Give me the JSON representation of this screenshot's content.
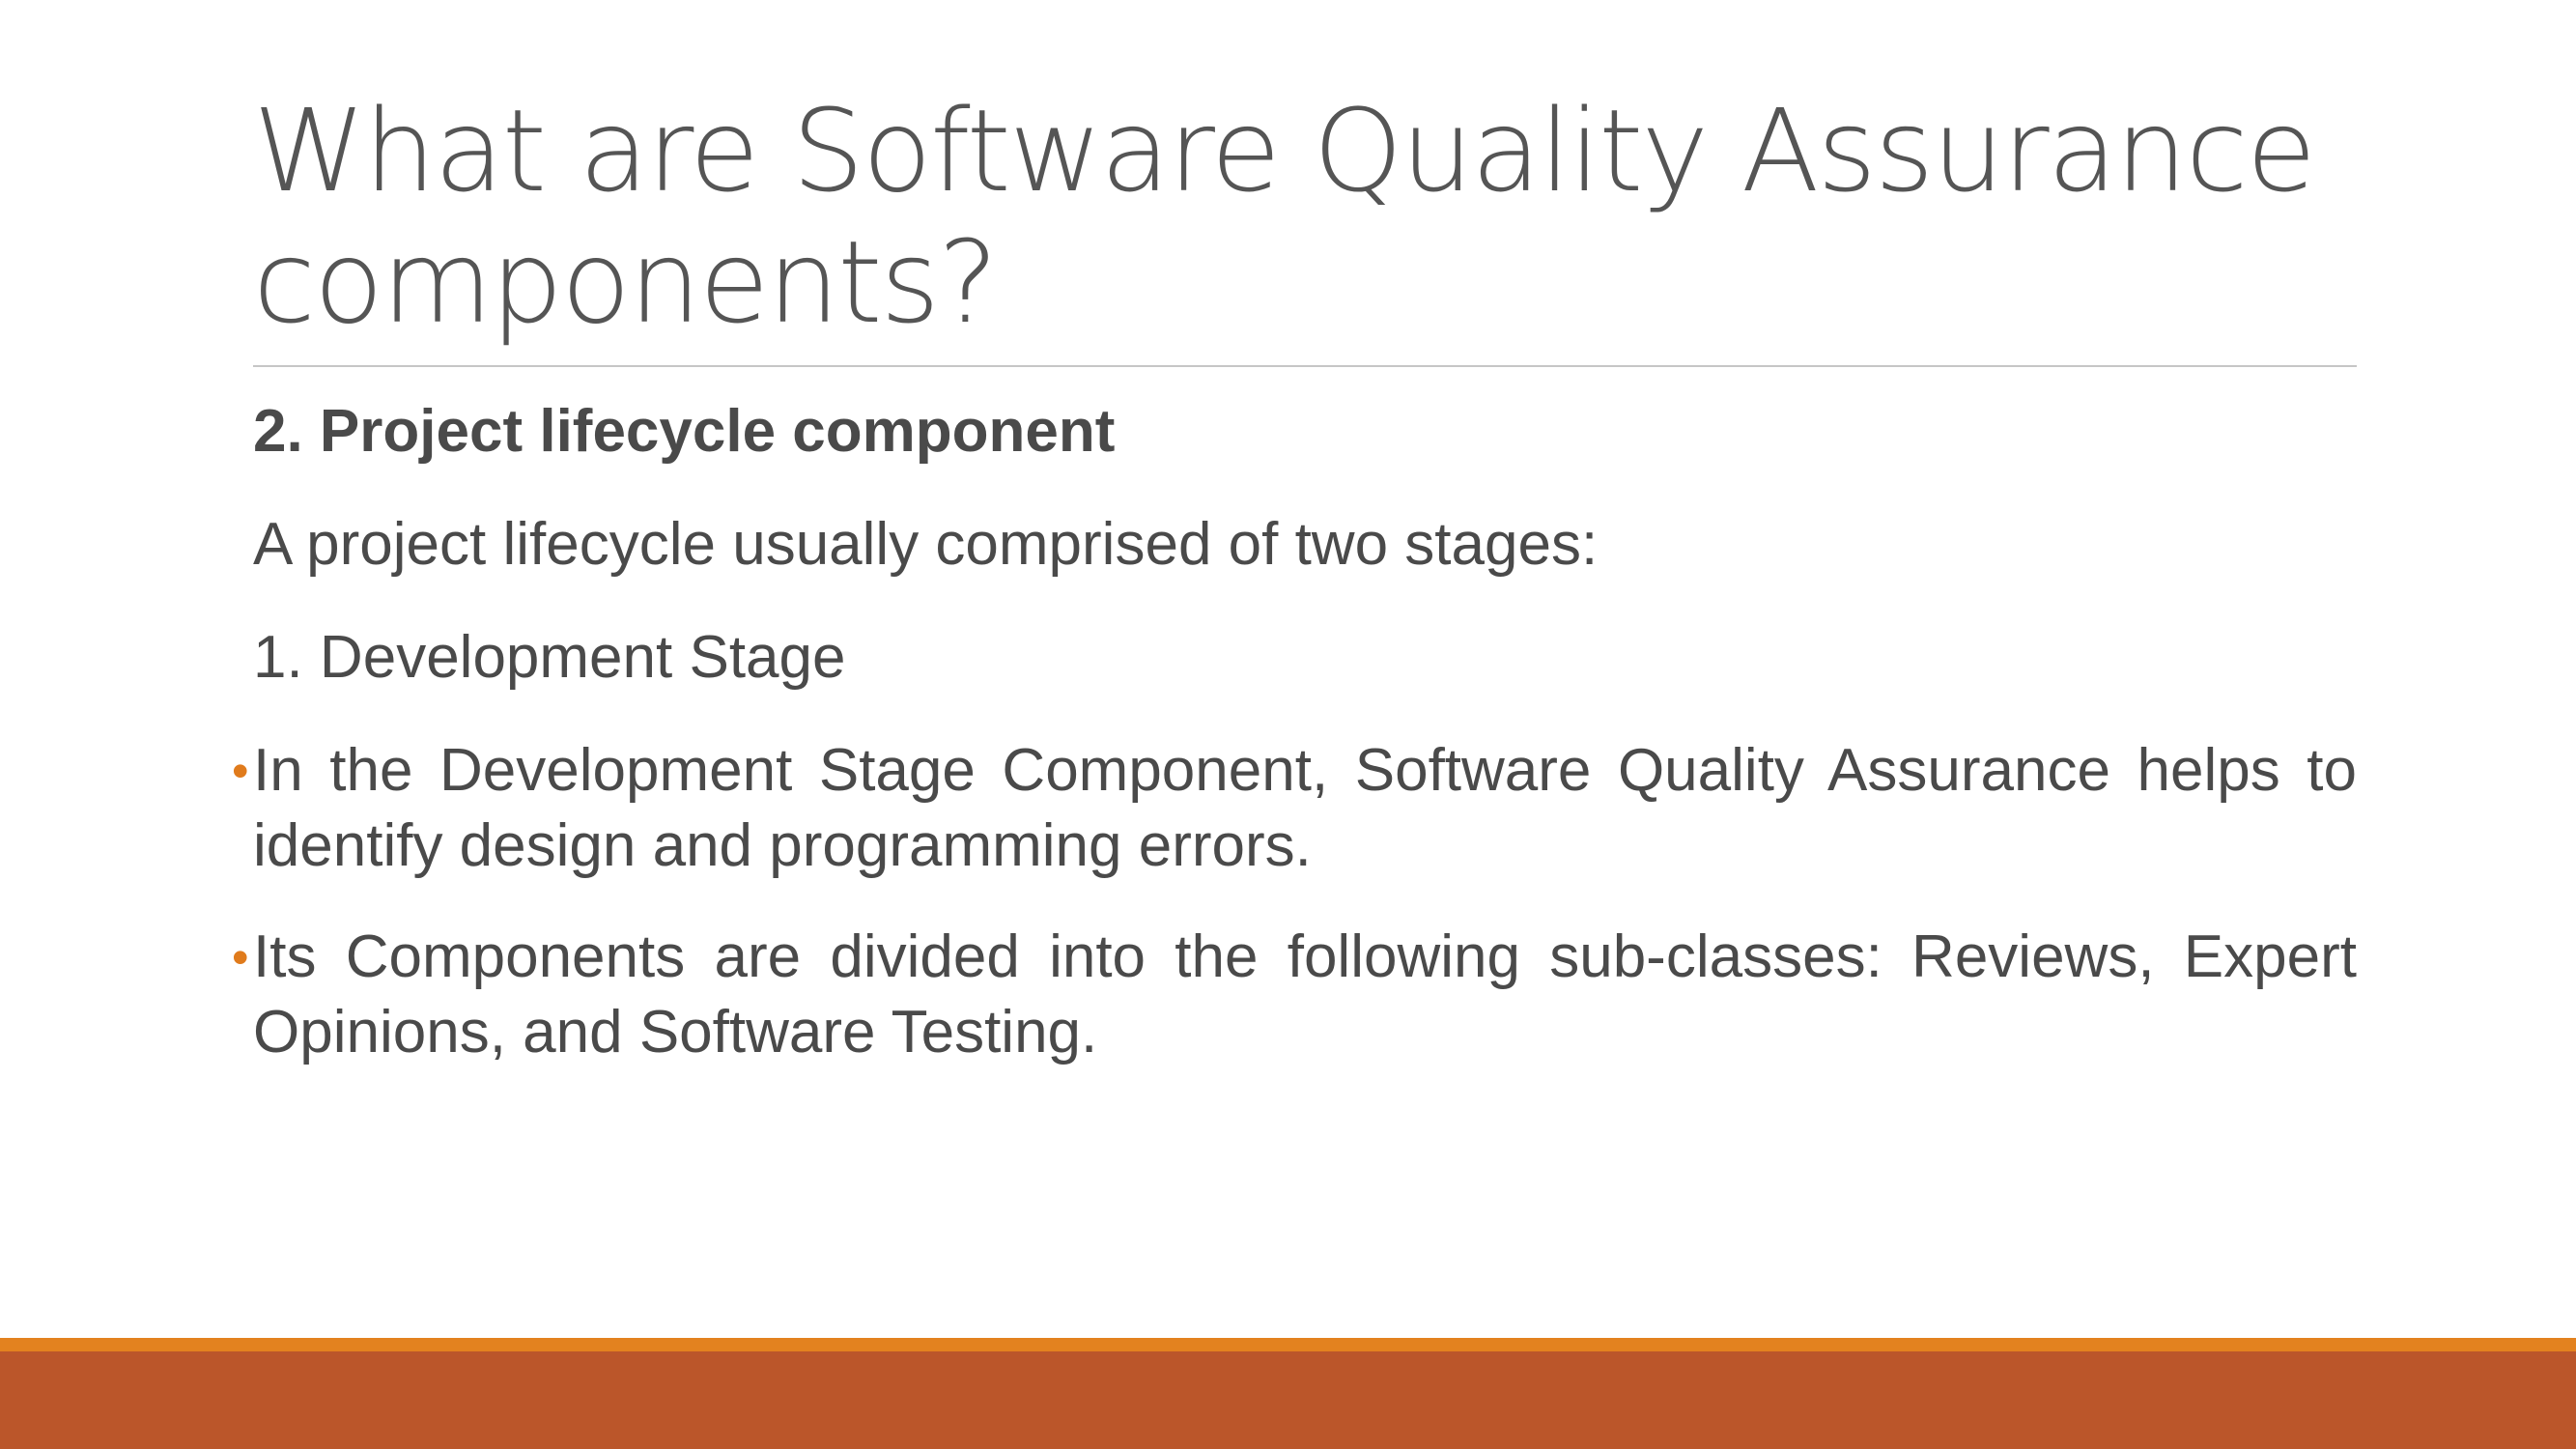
{
  "slide": {
    "title": "What are Software Quality Assurance components?",
    "heading": "2. Project lifecycle component",
    "intro": "A project lifecycle usually comprised of two stages:",
    "stage": "1. Development Stage",
    "bullets": [
      "In the Development Stage Component, Software Quality Assurance helps to identify design and programming errors.",
      "Its Components are divided into the following sub-classes: Reviews, Expert Opinions, and Software Testing."
    ],
    "bullet_glyph": "•"
  },
  "colors": {
    "title_text": "#555555",
    "body_text": "#4a4a4a",
    "bullet_accent": "#e07b1c",
    "footer_accent": "#e3821f",
    "footer_bar": "#bb562a",
    "rule": "#c6c6c6"
  }
}
